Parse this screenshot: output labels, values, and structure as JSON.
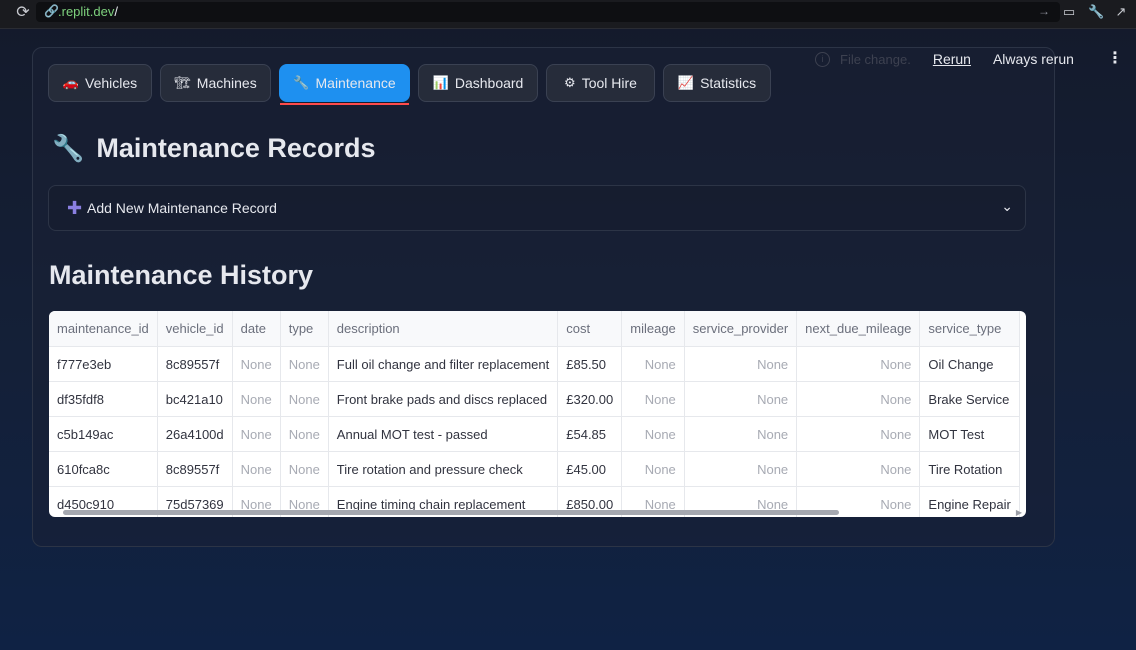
{
  "browser": {
    "url_domain": ".replit.dev",
    "url_path": "/"
  },
  "toolbar": {
    "file_change": "File change.",
    "rerun": "Rerun",
    "always_rerun": "Always rerun"
  },
  "tabs": [
    {
      "label": "Vehicles",
      "icon": "car-icon",
      "glyph": "🚗"
    },
    {
      "label": "Machines",
      "icon": "crane-icon",
      "glyph": "🏗"
    },
    {
      "label": "Maintenance",
      "icon": "wrench-icon",
      "glyph": "🔧",
      "active": true
    },
    {
      "label": "Dashboard",
      "icon": "bar-chart-icon",
      "glyph": "📊"
    },
    {
      "label": "Tool Hire",
      "icon": "gear-icon",
      "glyph": "⚙"
    },
    {
      "label": "Statistics",
      "icon": "line-chart-icon",
      "glyph": "📈"
    }
  ],
  "page": {
    "title": "Maintenance Records",
    "expander_label": "Add New Maintenance Record",
    "history_title": "Maintenance History"
  },
  "table": {
    "columns": [
      "maintenance_id",
      "vehicle_id",
      "date",
      "type",
      "description",
      "cost",
      "mileage",
      "service_provider",
      "next_due_mileage",
      "service_type"
    ],
    "rows": [
      [
        "f777e3eb",
        "8c89557f",
        "None",
        "None",
        "Full oil change and filter replacement",
        "£85.50",
        "None",
        "None",
        "None",
        "Oil Change"
      ],
      [
        "df35fdf8",
        "bc421a10",
        "None",
        "None",
        "Front brake pads and discs replaced",
        "£320.00",
        "None",
        "None",
        "None",
        "Brake Service"
      ],
      [
        "c5b149ac",
        "26a4100d",
        "None",
        "None",
        "Annual MOT test - passed",
        "£54.85",
        "None",
        "None",
        "None",
        "MOT Test"
      ],
      [
        "610fca8c",
        "8c89557f",
        "None",
        "None",
        "Tire rotation and pressure check",
        "£45.00",
        "None",
        "None",
        "None",
        "Tire Rotation"
      ],
      [
        "d450c910",
        "75d57369",
        "None",
        "None",
        "Engine timing chain replacement",
        "£850.00",
        "None",
        "None",
        "None",
        "Engine Repair"
      ]
    ]
  },
  "colors": {
    "accent": "#1e90f0",
    "active_underline": "#ff4b4b"
  }
}
